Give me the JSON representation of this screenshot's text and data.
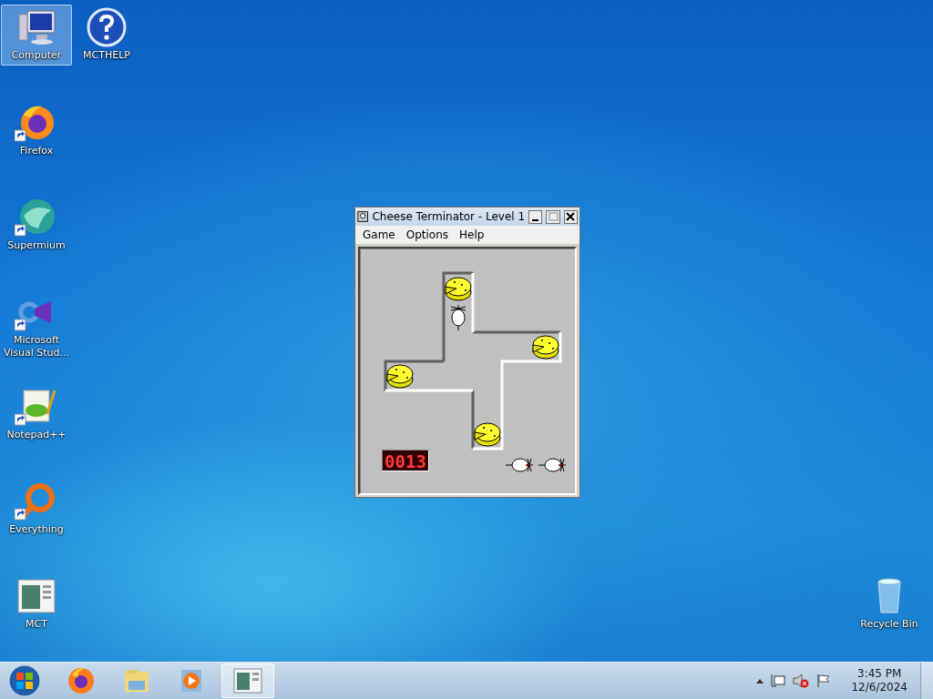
{
  "desktop_icons": [
    {
      "label": "Computer",
      "selected": true,
      "kind": "computer"
    },
    {
      "label": "MCTHELP",
      "selected": false,
      "kind": "help"
    },
    {
      "label": "Firefox",
      "selected": false,
      "kind": "firefox"
    },
    {
      "label": "Supermium",
      "selected": false,
      "kind": "supermium"
    },
    {
      "label": "Microsoft Visual Stud...",
      "selected": false,
      "kind": "vs"
    },
    {
      "label": "Notepad++",
      "selected": false,
      "kind": "notepad"
    },
    {
      "label": "Everything",
      "selected": false,
      "kind": "everything"
    },
    {
      "label": "MCT",
      "selected": false,
      "kind": "mct"
    },
    {
      "label": "Recycle Bin",
      "selected": false,
      "kind": "recycle"
    }
  ],
  "window": {
    "title": "Cheese Terminator - Level 1",
    "menu": [
      "Game",
      "Options",
      "Help"
    ],
    "counter": "0013"
  },
  "taskbar": {
    "items": [
      {
        "kind": "firefox",
        "selected": false
      },
      {
        "kind": "explorer",
        "selected": false
      },
      {
        "kind": "media",
        "selected": false
      },
      {
        "kind": "mct",
        "selected": true
      }
    ],
    "time": "3:45 PM",
    "date": "12/6/2024"
  }
}
